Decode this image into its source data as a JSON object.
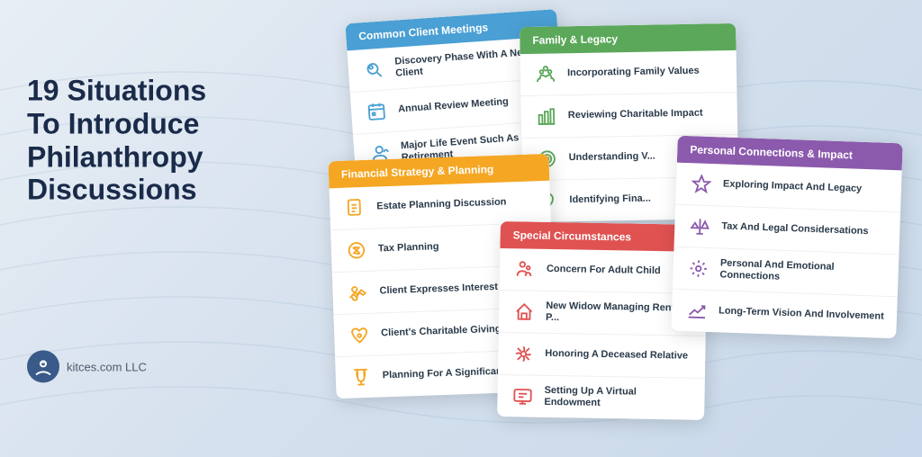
{
  "page": {
    "title": "19 Situations To Introduce Philanthropy Discussions",
    "brand": "kitces.com LLC"
  },
  "cards": {
    "common": {
      "header": "Common Client Meetings",
      "header_color": "#4a9fd4",
      "rows": [
        {
          "icon": "🔍",
          "text": "Discovery Phase With A New Client"
        },
        {
          "icon": "📅",
          "text": "Annual Review Meeting"
        },
        {
          "icon": "🏠",
          "text": "Major Life Event Such As Retirement"
        }
      ]
    },
    "financial": {
      "header": "Financial Strategy & Planning",
      "header_color": "#f5a623",
      "rows": [
        {
          "icon": "📋",
          "text": "Estate Planning Discussion"
        },
        {
          "icon": "💰",
          "text": "Tax Planning"
        },
        {
          "icon": "🤝",
          "text": "Client Expresses Interest In Gi..."
        },
        {
          "icon": "🎁",
          "text": "Client's Charitable Giving Incr..."
        },
        {
          "icon": "🏆",
          "text": "Planning For A Significant Win..."
        }
      ]
    },
    "family": {
      "header": "Family & Legacy",
      "header_color": "#5ba85a",
      "rows": [
        {
          "icon": "👨‍👩‍👧",
          "text": "Incorporating Family Values"
        },
        {
          "icon": "📊",
          "text": "Reviewing Charitable Impact"
        },
        {
          "icon": "🎯",
          "text": "Understanding V..."
        },
        {
          "icon": "🔍",
          "text": "Identifying Fina..."
        }
      ]
    },
    "special": {
      "header": "Special Circumstances",
      "header_color": "#e05252",
      "rows": [
        {
          "icon": "👨‍👧",
          "text": "Concern For Adult Child"
        },
        {
          "icon": "🏠",
          "text": "New Widow Managing Rental P..."
        },
        {
          "icon": "🌺",
          "text": "Honoring A Deceased Relative"
        },
        {
          "icon": "💻",
          "text": "Setting Up A Virtual Endowment"
        }
      ]
    },
    "personal": {
      "header": "Personal Connections & Impact",
      "header_color": "#8b5aad",
      "rows": [
        {
          "icon": "🌟",
          "text": "Exploring Impact And Legacy"
        },
        {
          "icon": "⚖️",
          "text": "Tax And Legal Considersations"
        },
        {
          "icon": "⚙️",
          "text": "Personal And Emotional Connections"
        },
        {
          "icon": "📈",
          "text": "Long-Term Vision And Involvement"
        }
      ]
    }
  }
}
